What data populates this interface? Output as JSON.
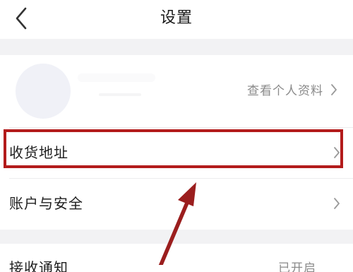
{
  "header": {
    "title": "设置",
    "back_icon": "chevron-left-icon"
  },
  "profile": {
    "link_label": "查看个人资料",
    "link_icon": "chevron-right-icon"
  },
  "settings": {
    "items": [
      {
        "label": "收货地址",
        "icon": "chevron-right-icon",
        "highlighted": true
      },
      {
        "label": "账户与安全",
        "icon": "chevron-right-icon",
        "highlighted": false
      }
    ]
  },
  "notifications": {
    "label": "接收通知",
    "status": "已开启"
  },
  "annotation": {
    "highlight_color": "#b31b1b",
    "arrow_color": "#9b1e1e"
  }
}
